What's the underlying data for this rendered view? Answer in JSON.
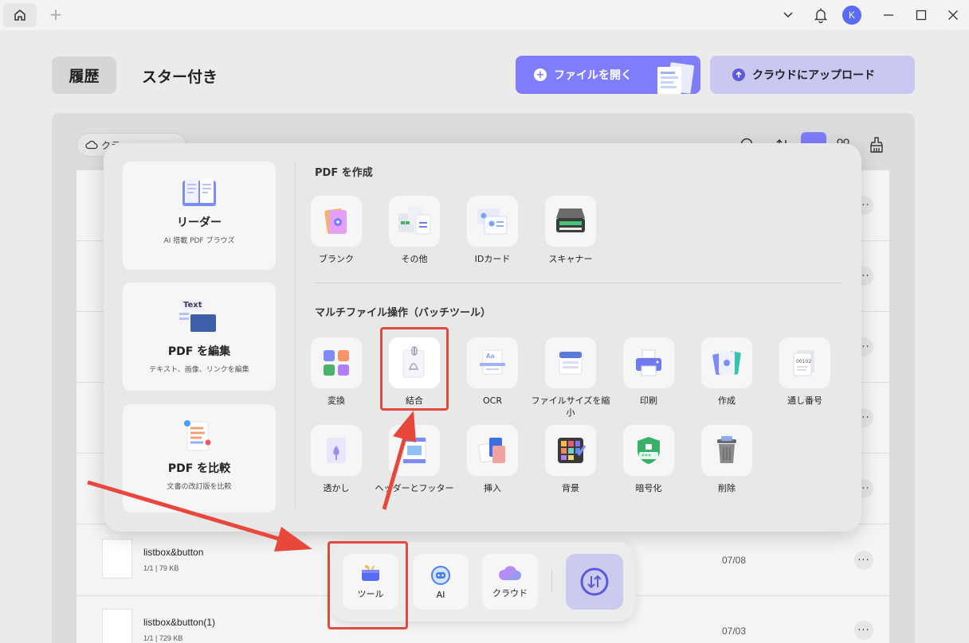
{
  "titlebar": {
    "avatar_initial": "K",
    "icons": [
      "home-icon",
      "plus-icon",
      "chevron-down-icon",
      "bell-icon",
      "minimize-icon",
      "maximize-icon",
      "close-icon"
    ]
  },
  "header": {
    "tab_history": "履歴",
    "tab_starred": "スター付き",
    "open_file_label": "ファイルを開く",
    "upload_label": "クラウドにアップロード"
  },
  "list": {
    "cloud_filter": "クラ…",
    "files": [
      {
        "name": "listbox&button",
        "meta": "1/1 | 79 KB",
        "date": "07/08"
      },
      {
        "name": "listbox&button(1)",
        "meta": "1/1 | 729 KB",
        "date": "07/03"
      }
    ]
  },
  "popup": {
    "cards": [
      {
        "title": "リーダー",
        "subtitle": "AI 搭載 PDF ブラウズ",
        "icon": "book-icon"
      },
      {
        "title": "PDF を編集",
        "subtitle": "テキスト、画像、リンクを編集",
        "icon": "edit-text-icon",
        "icon_text": "Text"
      },
      {
        "title": "PDF を比較",
        "subtitle": "文書の改訂版を比較",
        "icon": "compare-icon"
      }
    ],
    "create_section_title": "PDF を作成",
    "create_items": [
      {
        "label": "ブランク",
        "icon": "blank-page-icon"
      },
      {
        "label": "その他",
        "icon": "other-formats-icon"
      },
      {
        "label": "IDカード",
        "icon": "id-card-icon"
      },
      {
        "label": "スキャナー",
        "icon": "scanner-icon"
      }
    ],
    "batch_section_title": "マルチファイル操作（バッチツール）",
    "batch_items_row1": [
      {
        "label": "変換",
        "icon": "convert-icon"
      },
      {
        "label": "結合",
        "icon": "combine-icon"
      },
      {
        "label": "OCR",
        "icon": "ocr-icon"
      },
      {
        "label": "ファイルサイズを縮小",
        "icon": "compress-icon"
      },
      {
        "label": "印刷",
        "icon": "print-icon"
      },
      {
        "label": "作成",
        "icon": "create-icon"
      },
      {
        "label": "通し番号",
        "icon": "bates-number-icon"
      }
    ],
    "batch_items_row2": [
      {
        "label": "透かし",
        "icon": "watermark-icon"
      },
      {
        "label": "ヘッダーとフッター",
        "icon": "header-footer-icon"
      },
      {
        "label": "挿入",
        "icon": "insert-icon"
      },
      {
        "label": "背景",
        "icon": "background-icon"
      },
      {
        "label": "暗号化",
        "icon": "encrypt-icon"
      },
      {
        "label": "削除",
        "icon": "delete-icon"
      }
    ]
  },
  "bottom_toolbar": {
    "tools_label": "ツール",
    "ai_label": "AI",
    "cloud_label": "クラウド"
  },
  "colors": {
    "accent": "#7f7dfb",
    "accent_light": "#c9c8f0",
    "highlight": "#e04a3f"
  }
}
